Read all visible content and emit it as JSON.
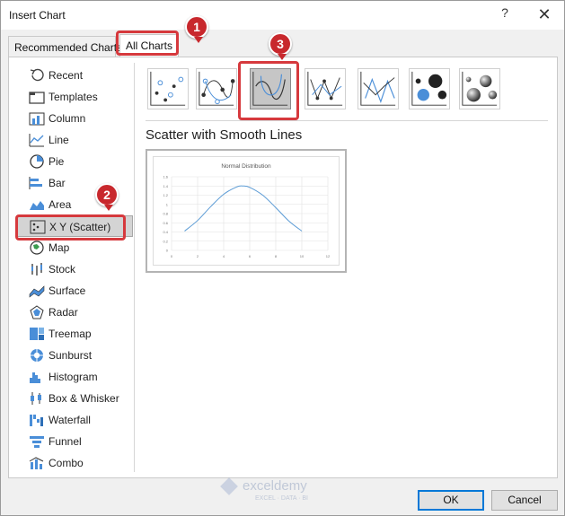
{
  "window": {
    "title": "Insert Chart",
    "help_glyph": "?",
    "close_glyph": "✕"
  },
  "tabs": [
    {
      "label": "Recommended Charts",
      "selected": false
    },
    {
      "label": "All Charts",
      "selected": true
    }
  ],
  "sidebar": {
    "items": [
      {
        "label": "Recent",
        "icon": "recent-icon"
      },
      {
        "label": "Templates",
        "icon": "templates-icon"
      },
      {
        "label": "Column",
        "icon": "column-chart-icon"
      },
      {
        "label": "Line",
        "icon": "line-chart-icon"
      },
      {
        "label": "Pie",
        "icon": "pie-chart-icon"
      },
      {
        "label": "Bar",
        "icon": "bar-chart-icon"
      },
      {
        "label": "Area",
        "icon": "area-chart-icon"
      },
      {
        "label": "X Y (Scatter)",
        "icon": "scatter-chart-icon",
        "selected": true
      },
      {
        "label": "Map",
        "icon": "map-chart-icon"
      },
      {
        "label": "Stock",
        "icon": "stock-chart-icon"
      },
      {
        "label": "Surface",
        "icon": "surface-chart-icon"
      },
      {
        "label": "Radar",
        "icon": "radar-chart-icon"
      },
      {
        "label": "Treemap",
        "icon": "treemap-chart-icon"
      },
      {
        "label": "Sunburst",
        "icon": "sunburst-chart-icon"
      },
      {
        "label": "Histogram",
        "icon": "histogram-chart-icon"
      },
      {
        "label": "Box & Whisker",
        "icon": "box-whisker-chart-icon"
      },
      {
        "label": "Waterfall",
        "icon": "waterfall-chart-icon"
      },
      {
        "label": "Funnel",
        "icon": "funnel-chart-icon"
      },
      {
        "label": "Combo",
        "icon": "combo-chart-icon"
      }
    ]
  },
  "subtypes": {
    "selected_index": 2,
    "items": [
      {
        "icon": "scatter-markers-icon"
      },
      {
        "icon": "scatter-smooth-lines-markers-icon"
      },
      {
        "icon": "scatter-smooth-lines-icon"
      },
      {
        "icon": "scatter-straight-lines-markers-icon"
      },
      {
        "icon": "scatter-straight-lines-icon"
      },
      {
        "icon": "bubble-icon"
      },
      {
        "icon": "bubble-3d-icon"
      }
    ],
    "selected_title": "Scatter with Smooth Lines"
  },
  "preview": {
    "chart_data": {
      "type": "line",
      "title": "Normal Distribution",
      "xlabel": "",
      "ylabel": "",
      "x_ticks": [
        "0",
        "2",
        "4",
        "6",
        "8",
        "10",
        "12"
      ],
      "y_ticks": [
        "0",
        "0.2",
        "0.4",
        "0.6",
        "0.8",
        "1",
        "1.2",
        "1.4",
        "1.6"
      ],
      "xlim": [
        0,
        12
      ],
      "ylim": [
        0,
        1.6
      ],
      "series": [
        {
          "x": [
            1,
            2,
            3,
            4,
            5,
            5.5,
            6,
            7,
            8,
            9,
            10
          ],
          "y": [
            0.42,
            0.65,
            0.95,
            1.22,
            1.38,
            1.4,
            1.37,
            1.2,
            0.93,
            0.64,
            0.42
          ]
        }
      ],
      "grid": true,
      "line_color": "#5b9bd5"
    }
  },
  "buttons": {
    "ok": "OK",
    "cancel": "Cancel"
  },
  "annotations": [
    {
      "number": "1",
      "target": "All Charts tab"
    },
    {
      "number": "2",
      "target": "X Y (Scatter)"
    },
    {
      "number": "3",
      "target": "Scatter with Smooth Lines"
    }
  ],
  "watermark": {
    "brand": "exceldemy",
    "tagline": "EXCEL · DATA · BI"
  },
  "colors": {
    "annotation_red": "#d6393d",
    "badge_red": "#c8282d",
    "accent_blue": "#0078d7"
  }
}
